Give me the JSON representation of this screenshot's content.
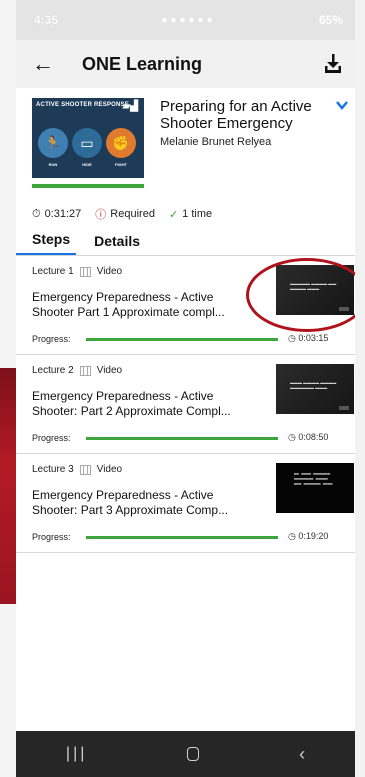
{
  "status_bar": {
    "time": "4:35",
    "battery": "65%"
  },
  "app_bar": {
    "title": "ONE Learning"
  },
  "course": {
    "title": "Preparing for an Active Shooter Emergency",
    "author": "Melanie Brunet Relyea",
    "thumbnail": {
      "heading": "ACTIVE SHOOTER RESPONSE",
      "labels": [
        "RUN",
        "HIDE",
        "FIGHT"
      ]
    }
  },
  "meta": {
    "duration": "0:31:27",
    "required": "Required",
    "times": "1 time"
  },
  "tabs": [
    {
      "label": "Steps",
      "active": true
    },
    {
      "label": "Details",
      "active": false
    }
  ],
  "lectures": [
    {
      "header": "Lecture 1",
      "type": "Video",
      "title_line1": "Emergency Preparedness - Active",
      "title_line2": "Shooter Part 1  Approximate compl...",
      "progress_label": "Progress:",
      "progress": 1.0,
      "duration": "0:03:15"
    },
    {
      "header": "Lecture 2",
      "type": "Video",
      "title_line1": "Emergency Preparedness - Active",
      "title_line2": "Shooter: Part 2 Approximate Compl...",
      "progress_label": "Progress:",
      "progress": 1.0,
      "duration": "0:08:50"
    },
    {
      "header": "Lecture 3",
      "type": "Video",
      "title_line1": "Emergency Preparedness - Active",
      "title_line2": "Shooter:  Part 3 Approximate Comp...",
      "progress_label": "Progress:",
      "progress": 1.0,
      "duration": "0:19:20"
    }
  ],
  "colors": {
    "progress": "#3ea43e",
    "accent": "#1a73e8",
    "annotation": "#b0121c"
  }
}
